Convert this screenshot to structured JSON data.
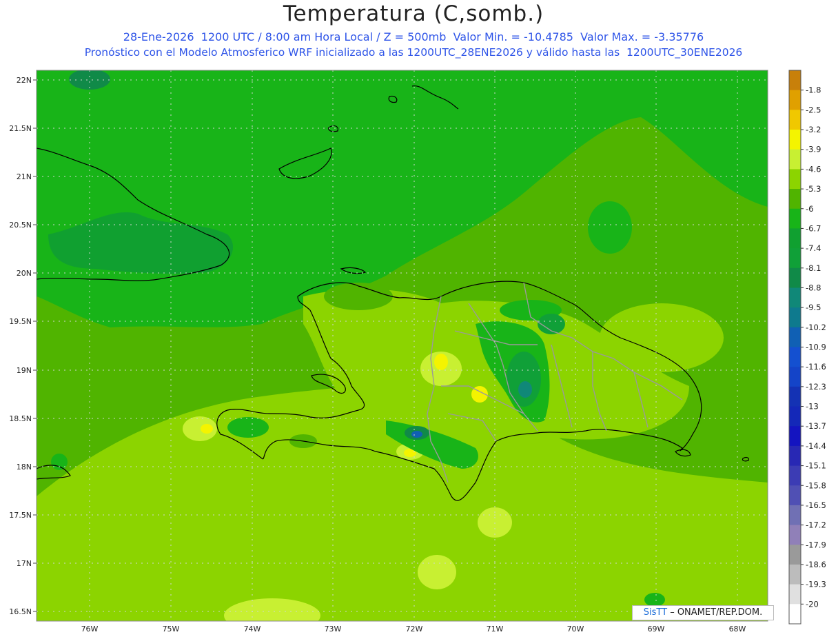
{
  "header": {
    "title": "Temperatura (C,somb.)",
    "subtitle_line1": "28-Ene-2026  1200 UTC / 8:00 am Hora Local / Z = 500mb  Valor Min. = -10.4785  Valor Max. = -3.35776",
    "subtitle_line2": "Pronóstico con el Modelo Atmosferico WRF inicializado a las 1200UTC_28ENE2026 y válido hasta las  1200UTC_30ENE2026"
  },
  "map": {
    "lat_labels": [
      "22N",
      "21.5N",
      "21N",
      "20.5N",
      "20N",
      "19.5N",
      "19N",
      "18.5N",
      "18N",
      "17.5N",
      "17N",
      "16.5N"
    ],
    "lon_labels": [
      "76W",
      "75W",
      "74W",
      "73W",
      "72W",
      "71W",
      "70W",
      "69W",
      "68W"
    ],
    "features": [
      "Cuba (oriental)",
      "Bahamas / Islas Turcas y Caicos",
      "Haití",
      "República Dominicana",
      "Jamaica (extremo este)",
      "Isla Gonâve"
    ]
  },
  "colorbar": {
    "levels": [
      "-1.8",
      "-2.5",
      "-3.2",
      "-3.9",
      "-4.6",
      "-5.3",
      "-6",
      "-6.7",
      "-7.4",
      "-8.1",
      "-8.8",
      "-9.5",
      "-10.2",
      "-10.9",
      "-11.6",
      "-12.3",
      "-13",
      "-13.7",
      "-14.4",
      "-15.1",
      "-15.8",
      "-16.5",
      "-17.2",
      "-17.9",
      "-18.6",
      "-19.3",
      "-20"
    ],
    "colors": [
      "#c8800a",
      "#e0a000",
      "#f0c800",
      "#f4f400",
      "#c8f032",
      "#8cd400",
      "#50b400",
      "#18b418",
      "#10a030",
      "#10a038",
      "#108a48",
      "#108878",
      "#0e7a8e",
      "#1060b4",
      "#1450d0",
      "#1444c8",
      "#1432b4",
      "#1428b8",
      "#1414c0",
      "#2828b4",
      "#3c3cb4",
      "#5050b4",
      "#7070b4",
      "#9080b8",
      "#9a9a9a",
      "#bcbcbc",
      "#e0e0e0",
      "#ffffff"
    ]
  },
  "credit": {
    "brand": "SisTT",
    "text": " – ONAMET/REP.DOM."
  }
}
